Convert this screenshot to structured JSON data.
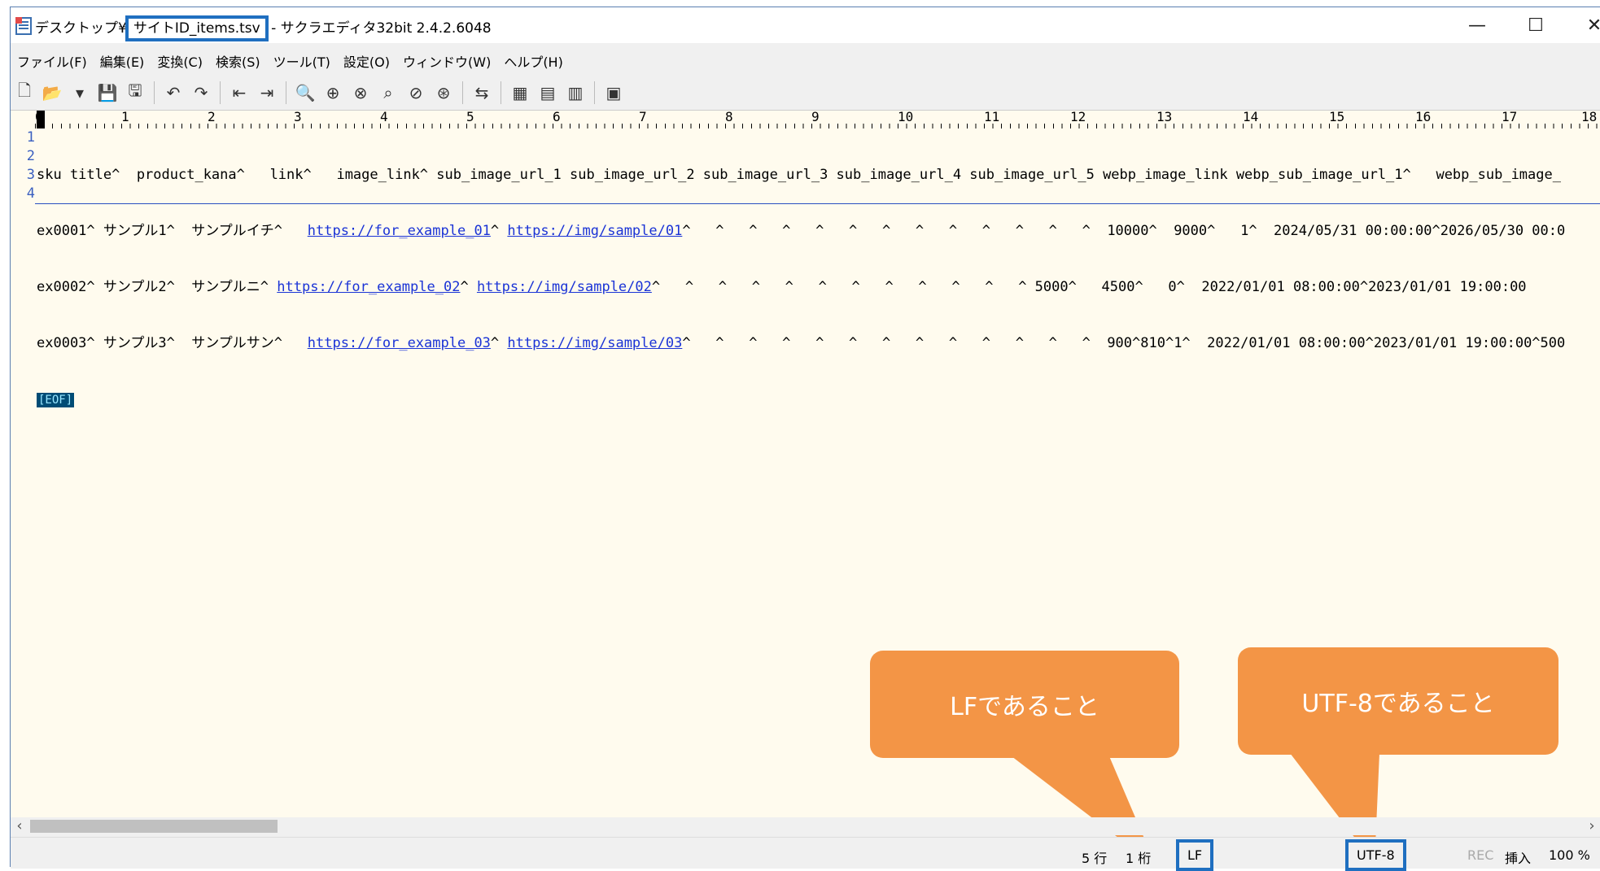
{
  "window": {
    "title_prefix": "デスクトップ¥",
    "filename": "サイトID_items.tsv",
    "title_suffix": " - サクラエディタ32bit 2.4.2.6048",
    "minimize": "—",
    "maximize": "☐",
    "close": "✕"
  },
  "menu": [
    "ファイル(F)",
    "編集(E)",
    "変換(C)",
    "検索(S)",
    "ツール(T)",
    "設定(O)",
    "ウィンドウ(W)",
    "ヘルプ(H)"
  ],
  "ruler_marks": [
    "0",
    "1",
    "2",
    "3",
    "4",
    "5",
    "6",
    "7",
    "8",
    "9",
    "10",
    "11",
    "12",
    "13",
    "14",
    "15",
    "16",
    "17",
    "18"
  ],
  "line_numbers": [
    "1",
    "2",
    "3",
    "4"
  ],
  "lines": {
    "l1": "sku title^  product_kana^   link^   image_link^ sub_image_url_1 sub_image_url_2 sub_image_url_3 sub_image_url_4 sub_image_url_5 webp_image_link webp_sub_image_url_1^   webp_sub_image_",
    "l2a": "ex0001^ サンプル1^  サンプルイチ^   ",
    "l2link1": "https://for_example_01",
    "l2b": "^ ",
    "l2link2": "https://img/sample/01",
    "l2c": "^   ^   ^   ^   ^   ^   ^   ^   ^   ^   ^   ^   ^  10000^  9000^   1^  2024/05/31 00:00:00^2026/05/30 00:0",
    "l3a": "ex0002^ サンプル2^  サンプルニ^ ",
    "l3link1": "https://for_example_02",
    "l3b": "^ ",
    "l3link2": "https://img/sample/02",
    "l3c": "^   ^   ^   ^   ^   ^   ^   ^   ^   ^   ^   ^ 5000^   4500^   0^  2022/01/01 08:00:00^2023/01/01 19:00:00",
    "l4a": "ex0003^ サンプル3^  サンプルサン^   ",
    "l4link1": "https://for_example_03",
    "l4b": "^ ",
    "l4link2": "https://img/sample/03",
    "l4c": "^   ^   ^   ^   ^   ^   ^   ^   ^   ^   ^   ^   ^  900^810^1^  2022/01/01 08:00:00^2023/01/01 19:00:00^500",
    "eof": "[EOF]"
  },
  "callouts": {
    "lf": "LFであること",
    "utf8": "UTF-8であること"
  },
  "status": {
    "row": "5 行",
    "col": "1 桁",
    "eol": "LF",
    "encoding": "UTF-8",
    "rec": "REC",
    "insert": "挿入",
    "zoom": "100 %"
  },
  "colors": {
    "accent": "#1f6fc0",
    "callout": "#f39546",
    "editor_bg": "#fffbee",
    "link": "#1a33d6"
  }
}
